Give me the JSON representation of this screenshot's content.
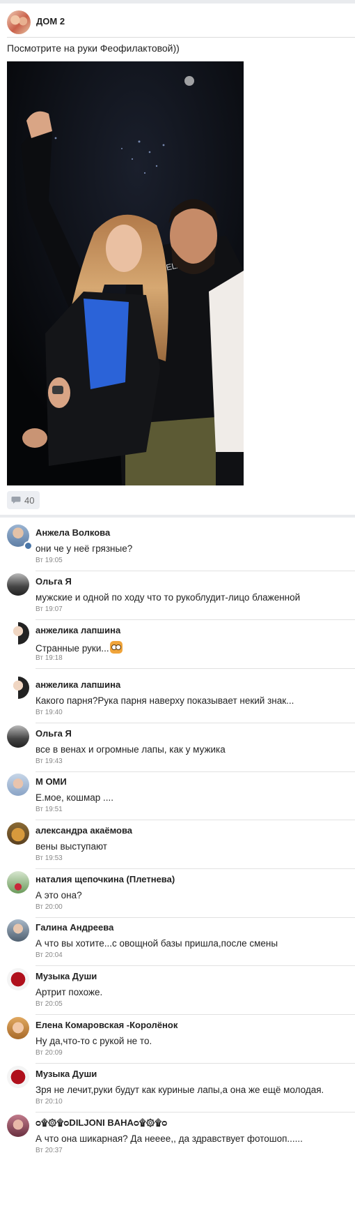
{
  "post": {
    "group_name": "ДОМ 2",
    "text": "Посмотрите на руки Феофилактовой))",
    "comments_count": "40"
  },
  "icons": {
    "group_avatar": "group-avatar-image",
    "comments": "speech-bubble-icon",
    "emoji": "cat-emoji-icon"
  },
  "comments": [
    {
      "author": "Анжела Волкова",
      "text": "они че у неё грязные?",
      "time": "Вт 19:05"
    },
    {
      "author": "Ольга Я",
      "text": "мужские и одной по ходу что то рукоблудит-лицо блаженной",
      "time": "Вт 19:07"
    },
    {
      "author": "анжелика лапшина",
      "text": "Странные руки...",
      "time": "Вт 19:18"
    },
    {
      "author": "анжелика лапшина",
      "text": "Какого парня?Рука парня наверху показывает некий знак...",
      "time": "Вт 19:40"
    },
    {
      "author": "Ольга Я",
      "text": "все в венах и огромные лапы, как у мужика",
      "time": "Вт 19:43"
    },
    {
      "author": "М ОМИ",
      "text": "Е.мое, кошмар ....",
      "time": "Вт 19:51"
    },
    {
      "author": "александра акаёмова",
      "text": "вены выступают",
      "time": "Вт 19:53"
    },
    {
      "author": "наталия щепочкина (Плетнева)",
      "text": "А это она?",
      "time": "Вт 20:00"
    },
    {
      "author": "Галина Андреева",
      "text": "А что вы хотите...с овощной базы пришла,после смены",
      "time": "Вт 20:04"
    },
    {
      "author": "Музыка Души",
      "text": "Артрит  похоже.",
      "time": "Вт 20:05"
    },
    {
      "author": "Елена Комаровская -Королёнок",
      "text": "Ну да,что-то с рукой не то.",
      "time": "Вт 20:09"
    },
    {
      "author": "Музыка Души",
      "text": "Зря не лечит,руки будут как куриные лапы,а она же ещё молодая.",
      "time": "Вт 20:10"
    },
    {
      "author": "ᴑ۩۞۩ᴑDILJONI BAHAᴑ۩۞۩ᴑ",
      "text": "А что она шикарная?  Да нееее,, да здравствует фотошоп......",
      "time": "Вт 20:37"
    }
  ],
  "colors": {
    "page_bg": "#e9ebee",
    "card_bg": "#ffffff",
    "accent": "#4a76a8",
    "meta_text": "#888888"
  }
}
